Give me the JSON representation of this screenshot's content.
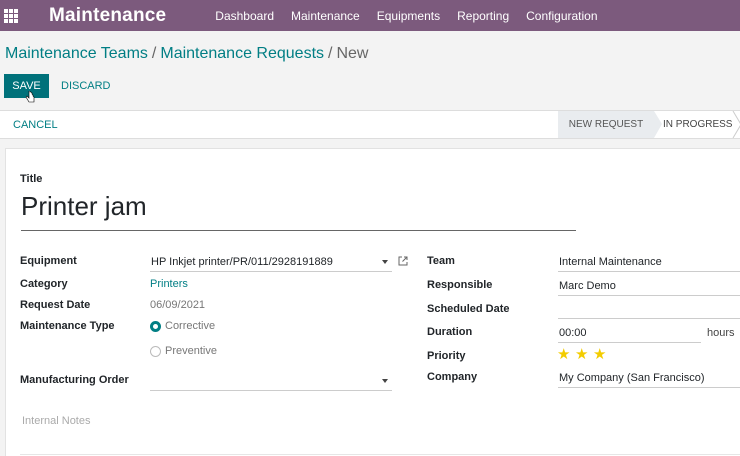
{
  "app": {
    "title": "Maintenance"
  },
  "nav": {
    "items": [
      "Dashboard",
      "Maintenance",
      "Equipments",
      "Reporting",
      "Configuration"
    ]
  },
  "breadcrumb": {
    "items": [
      "Maintenance Teams",
      "Maintenance Requests",
      "New"
    ],
    "separator": "/"
  },
  "actions": {
    "save": "SAVE",
    "discard": "DISCARD",
    "cancel": "CANCEL"
  },
  "stages": {
    "current": "NEW REQUEST",
    "next": "IN PROGRESS"
  },
  "form": {
    "title_label": "Title",
    "title_value": "Printer jam",
    "equipment": {
      "label": "Equipment",
      "value": "HP Inkjet printer/PR/011/2928191889"
    },
    "category": {
      "label": "Category",
      "value": "Printers"
    },
    "request_date": {
      "label": "Request Date",
      "value": "06/09/2021"
    },
    "maintenance_type": {
      "label": "Maintenance Type",
      "options": [
        "Corrective",
        "Preventive"
      ],
      "selected": "Corrective"
    },
    "manufacturing_order": {
      "label": "Manufacturing Order",
      "value": ""
    },
    "team": {
      "label": "Team",
      "value": "Internal Maintenance"
    },
    "responsible": {
      "label": "Responsible",
      "value": "Marc Demo"
    },
    "scheduled_date": {
      "label": "Scheduled Date",
      "value": ""
    },
    "duration": {
      "label": "Duration",
      "value": "00:00",
      "unit": "hours"
    },
    "priority": {
      "label": "Priority",
      "stars": 3,
      "max_stars": 3
    },
    "company": {
      "label": "Company",
      "value": "My Company (San Francisco)"
    },
    "notes_placeholder": "Internal Notes"
  },
  "colors": {
    "brand": "#7c5a7d",
    "primary": "#00717a",
    "link": "#017e84",
    "star": "#f3cc00"
  }
}
